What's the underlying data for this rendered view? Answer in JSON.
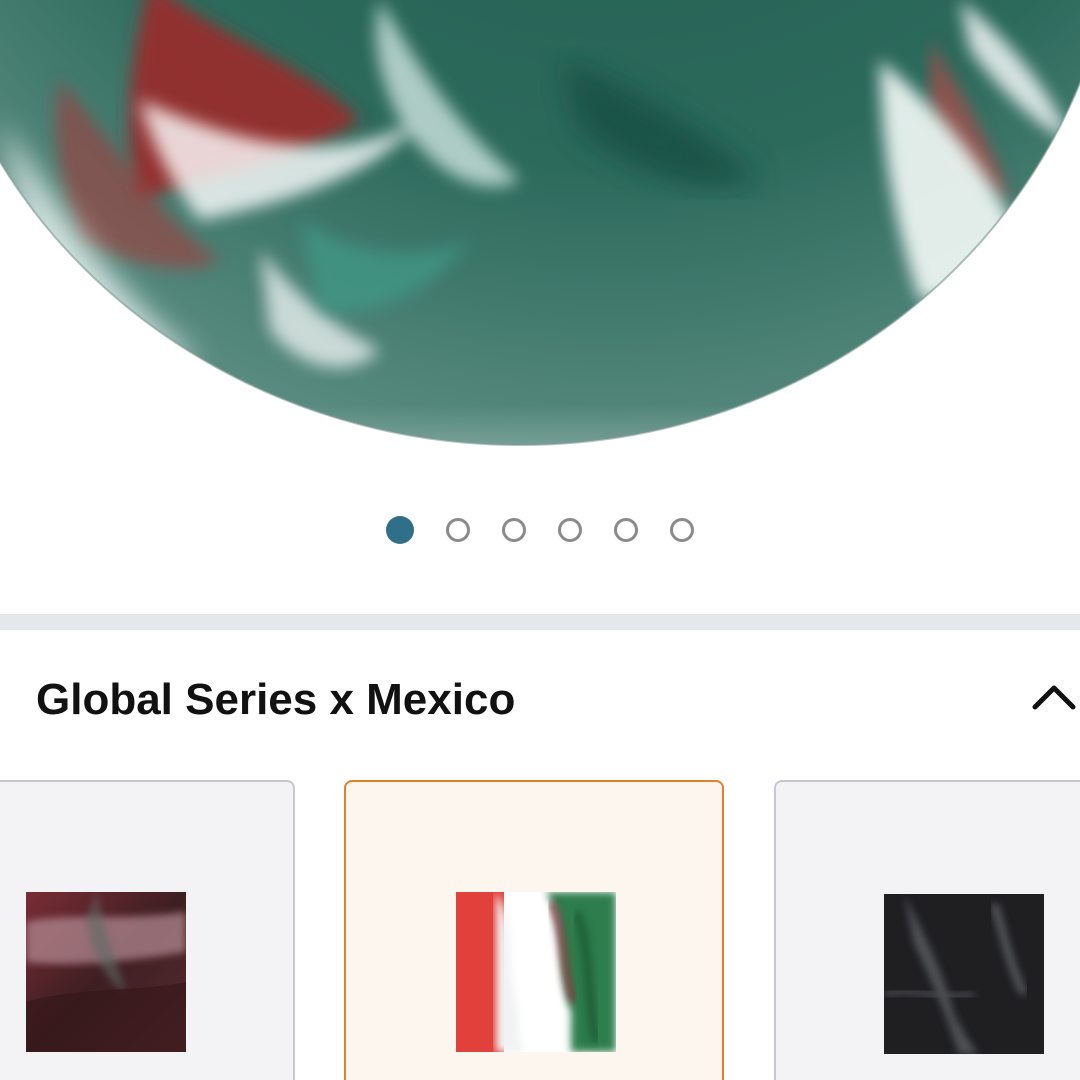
{
  "carousel": {
    "page_count": 6,
    "active_index": 0
  },
  "product_image": {
    "icon": "marbled-sphere-image"
  },
  "variation": {
    "label_suffix": ":",
    "selected_name": "Global Series x Mexico",
    "collapse_icon": "chevron-up-icon"
  },
  "swatches": [
    {
      "icon": "swatch-thumbnail-red-dark",
      "selected": false
    },
    {
      "icon": "swatch-thumbnail-mexico-flag",
      "selected": true
    },
    {
      "icon": "swatch-thumbnail-black-marble",
      "selected": false
    }
  ],
  "colors": {
    "dot_active": "#2f6f88",
    "dot_inactive_border": "#8a8a8a",
    "divider": "#e6e7e8",
    "swatch_selected_border": "#e0822d",
    "swatch_selected_bg": "#fdf6ef",
    "swatch_border": "#c5c8cf",
    "swatch_bg": "#f3f2f4"
  }
}
